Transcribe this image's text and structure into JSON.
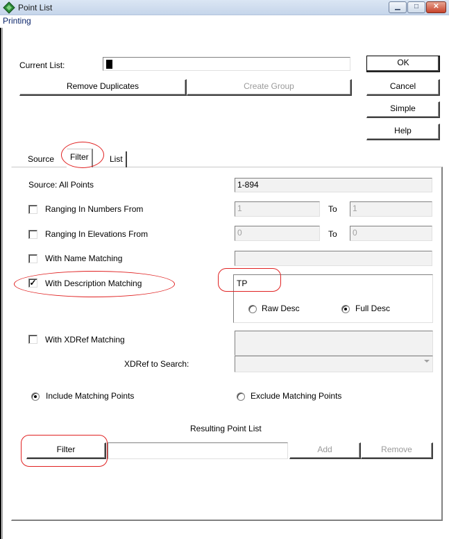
{
  "window": {
    "title": "Point List"
  },
  "menu": {
    "printing": "Printing"
  },
  "current_list": {
    "label": "Current List:",
    "value": ""
  },
  "buttons": {
    "remove_duplicates": "Remove Duplicates",
    "create_group": "Create Group",
    "ok": "OK",
    "cancel": "Cancel",
    "simple": "Simple",
    "help": "Help"
  },
  "tabs": [
    {
      "label": "Source"
    },
    {
      "label": "Filter"
    },
    {
      "label": "List"
    }
  ],
  "filter": {
    "source_label": "Source: All Points",
    "source_value": "1-894",
    "ranging_numbers": {
      "label": "Ranging In Numbers From",
      "checked": false,
      "from": "1",
      "to_label": "To",
      "to": "1"
    },
    "ranging_elevations": {
      "label": "Ranging In Elevations From",
      "checked": false,
      "from": "0",
      "to_label": "To",
      "to": "0"
    },
    "name_matching": {
      "label": "With Name Matching",
      "checked": false,
      "value": ""
    },
    "description_matching": {
      "label": "With Description Matching",
      "checked": true,
      "check_glyph": "✓",
      "value": "TP"
    },
    "desc_mode": {
      "raw": "Raw Desc",
      "full": "Full Desc",
      "selected": "Full Desc"
    },
    "xdref_matching": {
      "label": "With XDRef Matching",
      "checked": false,
      "value": ""
    },
    "xdref_search": {
      "label": "XDRef to Search:",
      "value": ""
    },
    "include_points": "Include Matching Points",
    "exclude_points": "Exclude Matching Points",
    "include_selected": "Include Matching Points",
    "resulting_label": "Resulting Point List",
    "filter_button": "Filter",
    "result_value": "",
    "add_button": "Add",
    "remove_button": "Remove"
  },
  "colors": {
    "annotation": "#e02020",
    "titlebar": "#c5d5ea",
    "menu_text": "#0a246a"
  }
}
